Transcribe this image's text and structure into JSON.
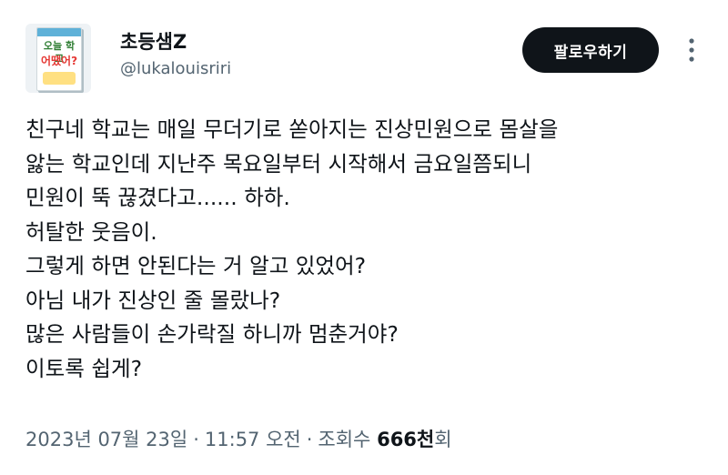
{
  "user": {
    "display_name": "초등샘Z",
    "handle": "@lukalouisriri",
    "avatar_book": {
      "title_line1": "오늘 학교",
      "title_line2": "어땠어?"
    }
  },
  "actions": {
    "follow_label": "팔로우하기",
    "more_icon": "more-vertical-icon"
  },
  "tweet": {
    "lines": [
      "친구네 학교는 매일 무더기로 쏟아지는 진상민원으로 몸살을",
      "앓는 학교인데 지난주 목요일부터 시작해서 금요일쯤되니",
      "민원이 뚝 끊겼다고...... 하하.",
      "허탈한 웃음이.",
      "그렇게 하면 안된다는 거 알고 있었어?",
      "아님 내가 진상인 줄 몰랐나?",
      "많은 사람들이  손가락질 하니까 멈춘거야?",
      "이토록 쉽게?"
    ]
  },
  "meta": {
    "date": "2023년 07월 23일",
    "separator": "·",
    "time": "11:57 오전",
    "views_label": "조회수",
    "views_count": "666천",
    "views_suffix": "회"
  },
  "colors": {
    "text_primary": "#0f1419",
    "text_secondary": "#536471",
    "button_bg": "#0f1419",
    "button_text": "#ffffff"
  }
}
